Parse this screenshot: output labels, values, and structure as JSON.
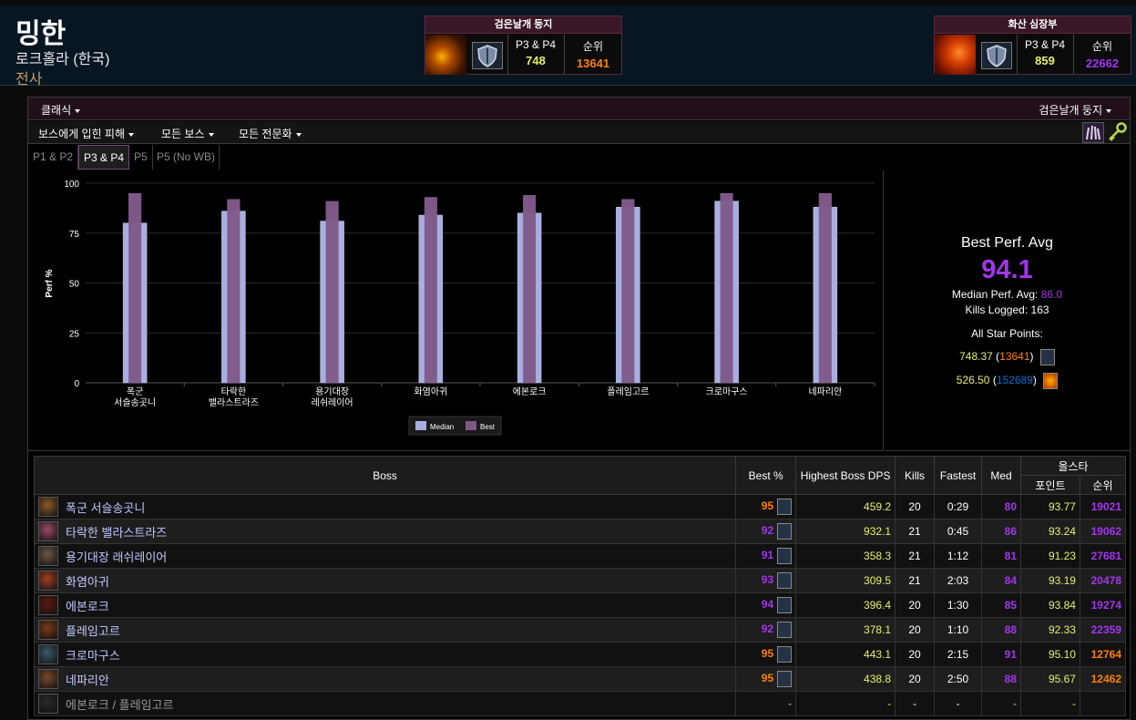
{
  "character": {
    "name": "밍한",
    "server": "로크홀라 (한국)",
    "class": "전사"
  },
  "zone_cards": [
    {
      "title": "검은날개 둥지",
      "phase_label": "P3 & P4",
      "phase_value": "748",
      "rank_label": "순위",
      "rank_value": "13641",
      "value_color": "#e6f06a",
      "rank_color": "#ff8000"
    },
    {
      "title": "화산 심장부",
      "phase_label": "P3 & P4",
      "phase_value": "859",
      "rank_label": "순위",
      "rank_value": "22662",
      "value_color": "#e6f06a",
      "rank_color": "#a335ee"
    }
  ],
  "toolbar": {
    "version": "클래식",
    "zone": "검은날개 둥지",
    "metric": "보스에게 입힌 피해",
    "boss": "모든 보스",
    "spec": "모든 전문화"
  },
  "tabs": [
    "P1 & P2",
    "P3 & P4",
    "P5",
    "P5 (No WB)"
  ],
  "chart_data": {
    "type": "bar",
    "categories": [
      "폭군 서슬송곳니",
      "타락한 밸라스트라즈",
      "용기대장 레쉬레이어",
      "화염아귀",
      "에본로크",
      "플레임고르",
      "크로마구스",
      "네파리안"
    ],
    "series": [
      {
        "name": "Median",
        "values": [
          80,
          86,
          81,
          84,
          85,
          88,
          91,
          88
        ],
        "color": "#a9aee0"
      },
      {
        "name": "Best",
        "values": [
          95,
          92,
          91,
          93,
          94,
          92,
          95,
          95
        ],
        "color": "#7d5987"
      }
    ],
    "ylabel": "Perf %",
    "ylim": [
      0,
      100
    ],
    "yticks": [
      "0",
      "25",
      "50",
      "75",
      "100"
    ],
    "legend": "bottom-center"
  },
  "stats": {
    "best_perf_label": "Best Perf. Avg",
    "best_perf_value": "94.1",
    "median_label": "Median Perf. Avg:",
    "median_value": "86.0",
    "kills_label": "Kills Logged:",
    "kills_value": "163",
    "allstar_label": "All Star Points:",
    "allstar": [
      {
        "points": "748.37",
        "rank": "13641",
        "rank_color": "#ff8000"
      },
      {
        "points": "526.50",
        "rank": "152689",
        "rank_color": "#0070dd"
      }
    ]
  },
  "table": {
    "headers": {
      "boss": "Boss",
      "best": "Best %",
      "dps": "Highest Boss DPS",
      "kills": "Kills",
      "fastest": "Fastest",
      "med": "Med",
      "allstar": "올스타",
      "points": "포인트",
      "rank": "순위"
    },
    "rows": [
      {
        "boss": "폭군 서슬송곳니",
        "best": "95",
        "dps": "459.2",
        "kills": "20",
        "fastest": "0:29",
        "med": "80",
        "points": "93.77",
        "rank": "19021",
        "best_color": "#ff8000",
        "med_color": "#a335ee",
        "rank_color": "#a335ee"
      },
      {
        "boss": "타락한 밸라스트라즈",
        "best": "92",
        "dps": "932.1",
        "kills": "21",
        "fastest": "0:45",
        "med": "86",
        "points": "93.24",
        "rank": "19062",
        "best_color": "#a335ee",
        "med_color": "#a335ee",
        "rank_color": "#a335ee"
      },
      {
        "boss": "용기대장 래쉬레이어",
        "best": "91",
        "dps": "358.3",
        "kills": "21",
        "fastest": "1:12",
        "med": "81",
        "points": "91.23",
        "rank": "27681",
        "best_color": "#a335ee",
        "med_color": "#a335ee",
        "rank_color": "#a335ee"
      },
      {
        "boss": "화염아귀",
        "best": "93",
        "dps": "309.5",
        "kills": "21",
        "fastest": "2:03",
        "med": "84",
        "points": "93.19",
        "rank": "20478",
        "best_color": "#a335ee",
        "med_color": "#a335ee",
        "rank_color": "#a335ee"
      },
      {
        "boss": "에본로크",
        "best": "94",
        "dps": "396.4",
        "kills": "20",
        "fastest": "1:30",
        "med": "85",
        "points": "93.84",
        "rank": "19274",
        "best_color": "#a335ee",
        "med_color": "#a335ee",
        "rank_color": "#a335ee"
      },
      {
        "boss": "플레임고르",
        "best": "92",
        "dps": "378.1",
        "kills": "20",
        "fastest": "1:10",
        "med": "88",
        "points": "92.33",
        "rank": "22359",
        "best_color": "#a335ee",
        "med_color": "#a335ee",
        "rank_color": "#a335ee"
      },
      {
        "boss": "크로마구스",
        "best": "95",
        "dps": "443.1",
        "kills": "20",
        "fastest": "2:15",
        "med": "91",
        "points": "95.10",
        "rank": "12764",
        "best_color": "#ff8000",
        "med_color": "#a335ee",
        "rank_color": "#ff8000"
      },
      {
        "boss": "네파리안",
        "best": "95",
        "dps": "438.8",
        "kills": "20",
        "fastest": "2:50",
        "med": "88",
        "points": "95.67",
        "rank": "12462",
        "best_color": "#ff8000",
        "med_color": "#a335ee",
        "rank_color": "#ff8000"
      },
      {
        "boss": "에본로크 / 플레임고르",
        "best": "-",
        "dps": "-",
        "kills": "-",
        "fastest": "-",
        "med": "-",
        "points": "-",
        "rank": "",
        "best_color": "#888888",
        "med_color": "#888888",
        "rank_color": "#888888"
      }
    ]
  }
}
